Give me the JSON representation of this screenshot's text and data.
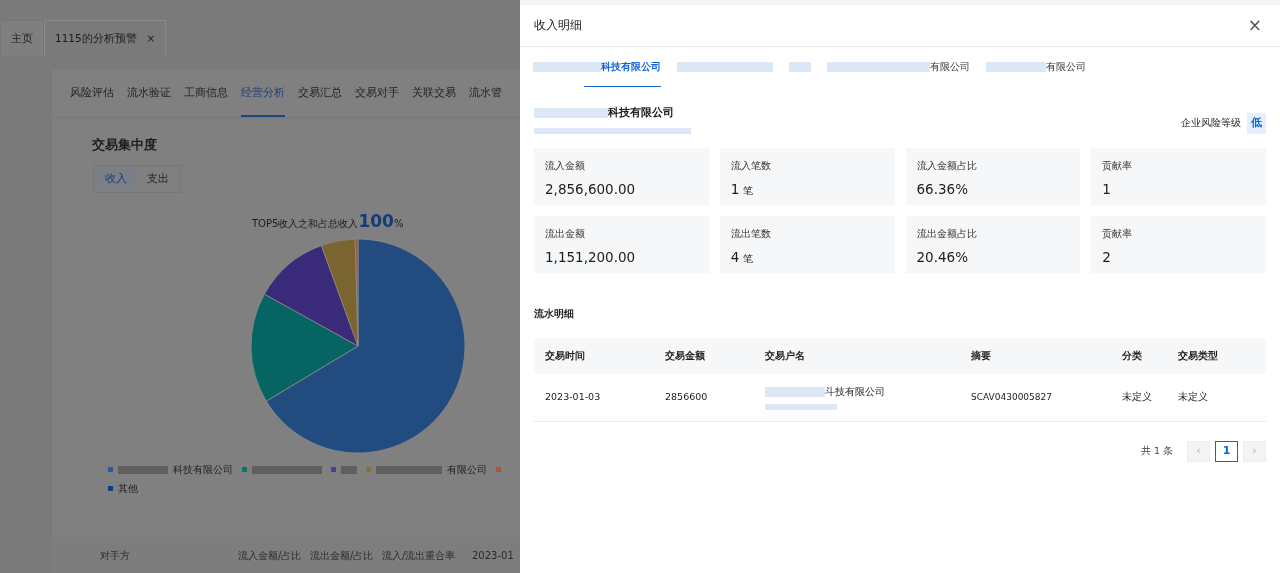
{
  "app_tabs": [
    {
      "label": "主页",
      "selected": false,
      "closable": false
    },
    {
      "label": "1115的分析预警",
      "selected": true,
      "closable": true,
      "close": "×"
    }
  ],
  "module_tabs": [
    {
      "label": "风险评估",
      "selected": false
    },
    {
      "label": "流水验证",
      "selected": false
    },
    {
      "label": "工商信息",
      "selected": false
    },
    {
      "label": "经营分析",
      "selected": true
    },
    {
      "label": "交易汇总",
      "selected": false
    },
    {
      "label": "交易对手",
      "selected": false
    },
    {
      "label": "关联交易",
      "selected": false
    },
    {
      "label": "流水管",
      "selected": false
    }
  ],
  "section_title": "交易集中度",
  "direction_toggle": [
    {
      "label": "收入",
      "selected": true
    },
    {
      "label": "支出",
      "selected": false
    }
  ],
  "chart_title": {
    "text": "TOP5收入之和占总收入",
    "figure": "100",
    "unit": "%"
  },
  "legend": [
    {
      "label": "科技有限公司",
      "color": "#2a5a9e",
      "redacted": true
    },
    {
      "color": "#0a7470",
      "redacted": true
    },
    {
      "color": "#4a3a9a",
      "redacted": true
    },
    {
      "label": "有限公司",
      "color": "#8a7038",
      "redacted": true
    },
    {
      "color": "#a05a38",
      "redacted": false
    },
    {
      "label": "其他",
      "color": "#103c80",
      "redacted": false
    }
  ],
  "bottom_table_columns": [
    "对手方",
    "流入金额/占比",
    "流出金额/占比",
    "流入/流出重合率",
    "2023-01"
  ],
  "drawer": {
    "title": "收入明细",
    "close": "×",
    "company_tabs": [
      {
        "label": "科技有限公司",
        "selected": true
      },
      {
        "selected": false
      },
      {
        "selected": false
      },
      {
        "label": "有限公司",
        "selected": false
      },
      {
        "label": "有限公司",
        "selected": false
      }
    ],
    "company_name": "科技有限公司",
    "risk_label": "企业风险等级",
    "risk_level": "低",
    "stats": [
      [
        {
          "label": "流入金额",
          "value": "2,856,600.00"
        },
        {
          "label": "流入笔数",
          "value": "1",
          "unit": "笔"
        },
        {
          "label": "流入金额占比",
          "value": "66.36%"
        },
        {
          "label": "贡献率",
          "value": "1"
        }
      ],
      [
        {
          "label": "流出金额",
          "value": "1,151,200.00"
        },
        {
          "label": "流出笔数",
          "value": "4",
          "unit": "笔"
        },
        {
          "label": "流出金额占比",
          "value": "20.46%"
        },
        {
          "label": "贡献率",
          "value": "2"
        }
      ]
    ],
    "detail_title": "流水明细",
    "table": {
      "columns": [
        "交易时间",
        "交易金额",
        "交易户名",
        "摘要",
        "分类",
        "交易类型"
      ],
      "rows": [
        {
          "cells": [
            "2023-01-03",
            "2856600",
            "斗技有限公司",
            "SCAV0430005827",
            "未定义",
            "未定义"
          ]
        }
      ]
    },
    "pagination": {
      "total": "共 1 条",
      "prev": "‹",
      "pages": [
        {
          "label": "1",
          "selected": true
        }
      ],
      "next": "›"
    }
  }
}
